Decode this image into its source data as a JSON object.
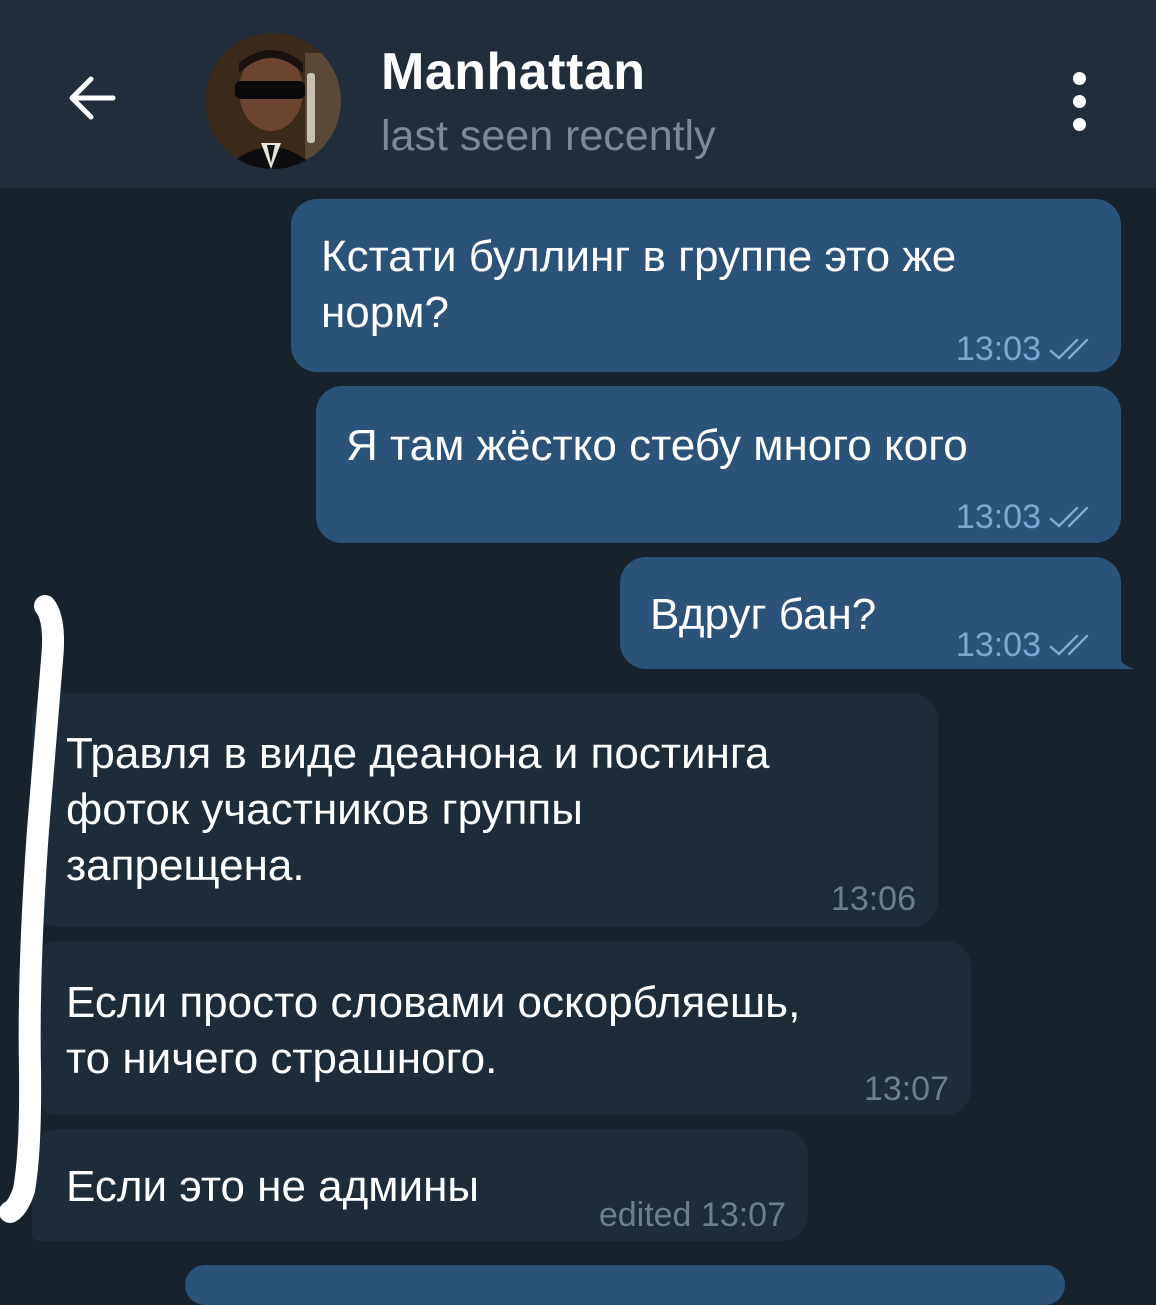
{
  "header": {
    "title": "Manhattan",
    "status": "last seen recently",
    "back_icon": "arrow-left-icon",
    "menu_icon": "more-vertical-icon"
  },
  "messages": [
    {
      "direction": "out",
      "text": "Кстати буллинг в группе это же норм?",
      "line1": "Кстати буллинг в группе это же",
      "line2": "норм?",
      "time": "13:03",
      "status": "read"
    },
    {
      "direction": "out",
      "text": "Я там жёстко стебу много кого",
      "time": "13:03",
      "status": "read"
    },
    {
      "direction": "out",
      "text": "Вдруг бан?",
      "time": "13:03",
      "status": "read"
    },
    {
      "direction": "in",
      "text": "Травля в виде деанона и постинга фоток участников группы запрещена.",
      "line1": "Травля в виде деанона и постинга",
      "line2": "фоток участников группы",
      "line3": "запрещена.",
      "time": "13:06"
    },
    {
      "direction": "in",
      "text": "Если просто словами оскорбляешь, то ничего страшного.",
      "line1": "Если просто словами оскорбляешь,",
      "line2": "то ничего страшного.",
      "time": "13:07"
    },
    {
      "direction": "in",
      "text": "Если это не админы",
      "time": "edited 13:07"
    }
  ],
  "colors": {
    "background": "#18222d",
    "header": "#212d3b",
    "outgoing_bubble": "#2b5278",
    "incoming_bubble": "#182533",
    "read_ticks": "#7da8d3"
  }
}
